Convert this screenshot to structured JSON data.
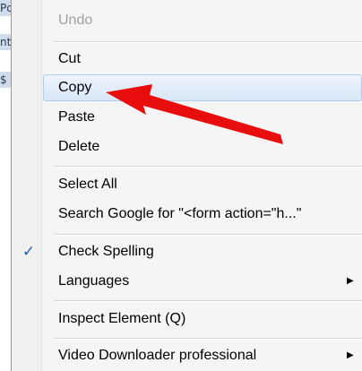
{
  "background": {
    "fragments": [
      "Pc",
      "nt",
      "$"
    ]
  },
  "menu": {
    "items": {
      "undo": "Undo",
      "cut": "Cut",
      "copy": "Copy",
      "paste": "Paste",
      "delete": "Delete",
      "select_all": "Select All",
      "search_google": "Search Google for \"<form action=\"h...\"",
      "check_spelling": "Check Spelling",
      "languages": "Languages",
      "inspect_element": "Inspect Element (Q)",
      "video_downloader": "Video Downloader professional"
    },
    "check_spelling_checked": true,
    "highlighted_item": "Copy",
    "submenu_arrow_glyph": "▶",
    "check_glyph": "✓"
  },
  "annotation": {
    "arrow_color": "#e80e0e",
    "points_to": "Copy"
  },
  "colors": {
    "highlight_border": "#aecdf0",
    "disabled_text": "#a0a0a0",
    "check": "#1f5fb0"
  }
}
